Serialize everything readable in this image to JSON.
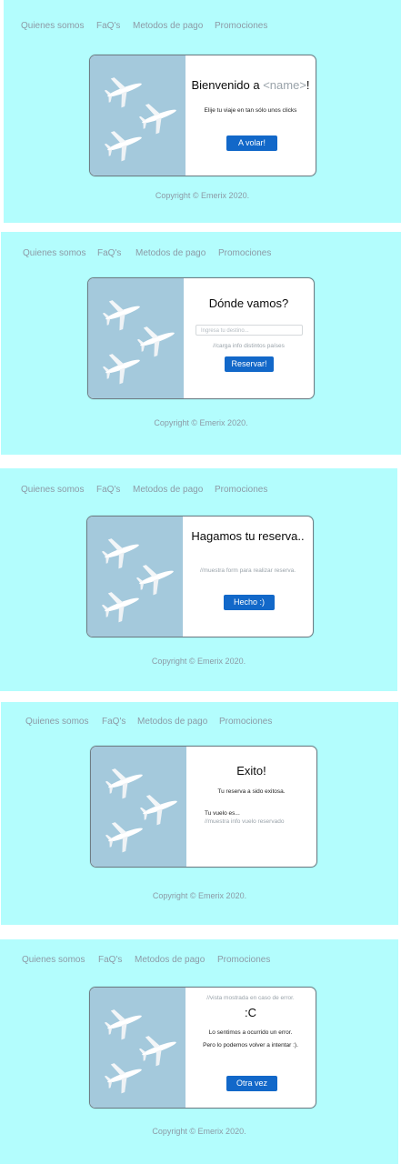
{
  "nav": [
    "Quienes somos",
    "FaQ's",
    "Metodos de pago",
    "Promociones"
  ],
  "copyright": "Copyright © Emerix 2020.",
  "screen1": {
    "title_prefix": "Bienvenido a ",
    "title_placeholder": "<name>",
    "title_suffix": "!",
    "subtitle": "Elije tu viaje en tan sólo unos clicks",
    "button": "A volar!"
  },
  "screen2": {
    "title": "Dónde vamos?",
    "input_placeholder": "Ingresa tu destino...",
    "note": "//carga info distintos países",
    "button": "Reservar!"
  },
  "screen3": {
    "title": "Hagamos tu reserva..",
    "note": "//muestra form para realizar reserva.",
    "button": "Hecho :)"
  },
  "screen4": {
    "title": "Exito!",
    "message": "Tu reserva a sido exitosa.",
    "flight_label": "Tu vuelo es...",
    "note": "//muestra info vuelo reservado"
  },
  "screen5": {
    "note": "//vista mostrada en caso de error.",
    "face": ":C",
    "line1": "Lo sentimos a ocurrido un error.",
    "line2": "Pero lo podemos volver a intentar :).",
    "button": "Otra vez"
  }
}
